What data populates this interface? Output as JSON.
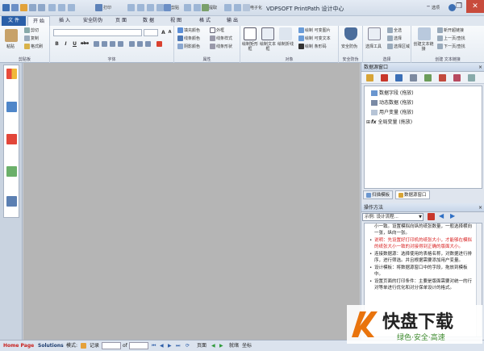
{
  "window": {
    "title": "VDPSOFT PrintPath 设计中心",
    "minimize_icon": "minimize-icon",
    "restore_icon": "restore-icon",
    "close_icon": "close-icon"
  },
  "quick_access": {
    "items": [
      "打印",
      "剪贴",
      "提取",
      "复制",
      "电子化"
    ],
    "right": [
      "选项",
      "帮助"
    ]
  },
  "tabs": [
    "文 件",
    "开 始",
    "插 入",
    "安全防伪",
    "页 面",
    "数 据",
    "视 图",
    "格 式",
    "输 出"
  ],
  "active_tab": "开 始",
  "ribbon": {
    "clipboard": {
      "label": "剪贴板",
      "paste": "粘贴",
      "cut": "剪切",
      "copy": "复制",
      "format_painter": "格式刷"
    },
    "font": {
      "label": "字体",
      "bold": "B",
      "italic": "I",
      "underline": "U",
      "strike": "abc",
      "grow": "A",
      "shrink": "A"
    },
    "attributes": {
      "label": "属性",
      "items": [
        "填充颜色",
        "线条颜色",
        "阴影颜色",
        "外框",
        "线条样式",
        "线条形状"
      ]
    },
    "objects": {
      "label": "对象",
      "draw_rect": "绘制矩形框",
      "draw_text": "绘制文本框",
      "draw_polyline": "绘制折线",
      "draw_table": "绘制表格",
      "items": [
        "绘制 可变图片",
        "绘制 可变文本",
        "绘制 条形码"
      ]
    },
    "security": {
      "label": "安全防伪",
      "btn": "安全防伪"
    },
    "select": {
      "label": "选择",
      "select_tool": "选择工具",
      "items": [
        "全选",
        "选择",
        "选择区域"
      ]
    },
    "find": {
      "label": "查找",
      "create_link": "创建文本链接",
      "items": [
        "新开超链接",
        "上一页/查找",
        "下一页/查找"
      ],
      "group_label": "创建 文本链接"
    }
  },
  "left_toolbar": {
    "icons": [
      "start-icon",
      "print-icon",
      "pdf-icon",
      "image-icon",
      "export-icon"
    ]
  },
  "datasource_panel": {
    "title": "数据源窗口",
    "close": "×",
    "toolbar_icons": [
      "database-icon",
      "sql-icon",
      "filter-icon",
      "grid-icon",
      "table-add-icon",
      "table-edit-icon",
      "table-remove-icon",
      "table-refresh-icon"
    ],
    "tree": [
      "数据字段 (拖放)",
      "动态数据 (拖放)",
      "用户变量 (拖放)",
      "全局变量 (拖放)"
    ],
    "tabs": [
      "扫描模板",
      "数据源窗口"
    ]
  },
  "help_panel": {
    "title": "操作方法",
    "close": "×",
    "combo_value": "示例: 设计流程...",
    "items": [
      {
        "text": "小一致。设置模拟向纵的纸张数量，一般选择横向一张，纵向一张。",
        "style": "plain"
      },
      {
        "text": "说明：先设置好打印机的纸张大小，才能够在模拟的纸张大小一致的对接得到正确的版面大小。",
        "style": "red"
      },
      {
        "text": "连接数据源：选择使用的表格名称，对数据进行排序，进行筛选。并且根据需要添加用户变量。",
        "style": "normal"
      },
      {
        "text": "设计模板：将数据源窗口中的字段，拖放到模板中。",
        "style": "normal"
      },
      {
        "text": "设置页面的打印条件：主要是版面需要对统一的行对等单进行优化和对分保单设计的格式。",
        "style": "normal"
      }
    ]
  },
  "status_bar": {
    "home_page": "Home Page",
    "solutions": "Solutions",
    "mode_label": "模式:",
    "record_label": "记录",
    "of_label": "of",
    "page_label": "页面",
    "ready": "就绪",
    "coords": "坐标"
  },
  "watermark": {
    "brand": "快盘下载",
    "slogan": "绿色·安全·高速"
  },
  "colors": {
    "accent": "#2a5fa8",
    "close": "#c84b3c",
    "red_text": "#d81e1e",
    "canvas": "#b5b5b5",
    "status_red": "#c8201c"
  }
}
